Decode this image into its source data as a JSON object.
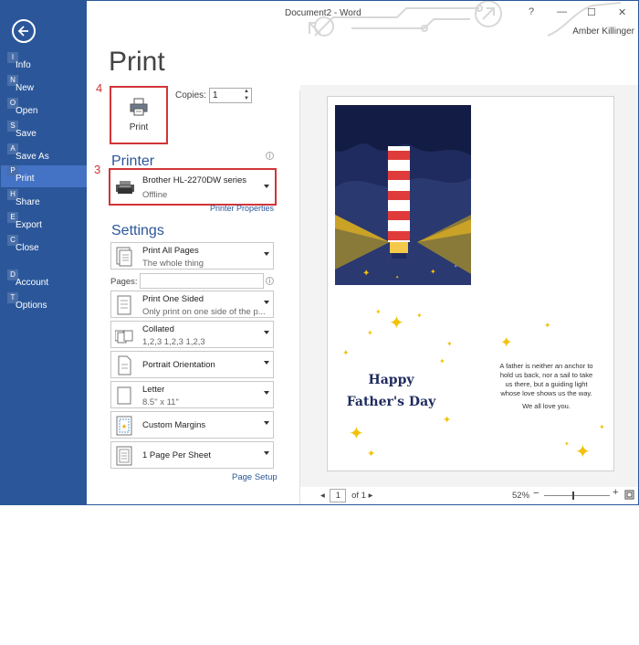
{
  "window": {
    "title": "Document2 - Word",
    "user": "Amber Killinger",
    "help": "?",
    "minimize": "—",
    "maximize": "☐",
    "close": "✕"
  },
  "sidebar": {
    "items": [
      {
        "key": "I",
        "label": "Info"
      },
      {
        "key": "N",
        "label": "New"
      },
      {
        "key": "O",
        "label": "Open"
      },
      {
        "key": "S",
        "label": "Save"
      },
      {
        "key": "A",
        "label": "Save As"
      },
      {
        "key": "P",
        "label": "Print"
      },
      {
        "key": "H",
        "label": "Share"
      },
      {
        "key": "E",
        "label": "Export"
      },
      {
        "key": "C",
        "label": "Close"
      },
      {
        "key": "D",
        "label": "Account"
      },
      {
        "key": "T",
        "label": "Options"
      }
    ]
  },
  "print": {
    "heading": "Print",
    "button_label": "Print",
    "copies_label": "Copies:",
    "copies_value": "1",
    "step_print": "4",
    "step_printer": "3"
  },
  "printer": {
    "heading": "Printer",
    "name": "Brother HL-2270DW series",
    "status": "Offline",
    "properties_link": "Printer Properties",
    "info": "i"
  },
  "settings": {
    "heading": "Settings",
    "print_range": {
      "title": "Print All Pages",
      "desc": "The whole thing"
    },
    "pages_label": "Pages:",
    "pages_value": "",
    "pages_info": "i",
    "sides": {
      "title": "Print One Sided",
      "desc": "Only print on one side of the p..."
    },
    "collation": {
      "title": "Collated",
      "desc": "1,2,3   1,2,3   1,2,3"
    },
    "orientation": {
      "title": "Portrait Orientation"
    },
    "paper": {
      "title": "Letter",
      "desc": "8.5\" x 11\""
    },
    "margins": {
      "title": "Custom Margins"
    },
    "per_sheet": {
      "title": "1 Page Per Sheet"
    },
    "page_setup_link": "Page Setup"
  },
  "preview": {
    "card_title_line1": "Happy",
    "card_title_line2": "Father's Day",
    "verse": "A father is neither an anchor to hold us back, nor a sail to take us there, but a guiding light whose love shows us the way.",
    "signature": "We all love you.",
    "page_current": "1",
    "page_total": "of 1",
    "zoom": "52%",
    "colors": {
      "navy": "#1f2b5e",
      "star": "#f2c20c",
      "stripe_red": "#e03b3b"
    }
  }
}
